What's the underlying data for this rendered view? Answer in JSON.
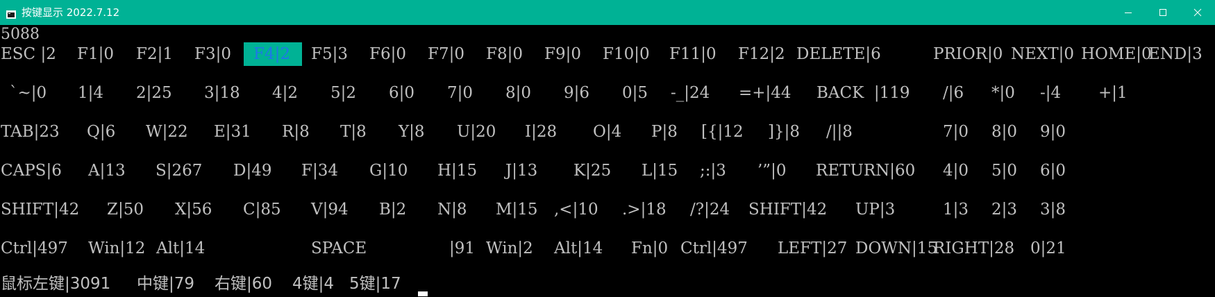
{
  "window": {
    "title": "按键显示 2022.7.12",
    "minimize_glyph": "─",
    "maximize_glyph": "☐",
    "close_glyph": "✕",
    "accent_color": "#00b295"
  },
  "console": {
    "counter": "5088",
    "text_color": "#c0c0c0",
    "highlight_text_color": "#1e78e6"
  },
  "rows": [
    {
      "name": "function-row",
      "keys": [
        {
          "id": "esc",
          "text": "ESC |2"
        },
        {
          "id": "f1",
          "text": "F1|0"
        },
        {
          "id": "f2",
          "text": "F2|1"
        },
        {
          "id": "f3",
          "text": "F3|0"
        },
        {
          "id": "f4",
          "text": "F4|2 ",
          "active": true
        },
        {
          "id": "f5",
          "text": "F5|3"
        },
        {
          "id": "f6",
          "text": "F6|0"
        },
        {
          "id": "f7",
          "text": "F7|0"
        },
        {
          "id": "f8",
          "text": "F8|0"
        },
        {
          "id": "f9",
          "text": "F9|0"
        },
        {
          "id": "f10",
          "text": "F10|0"
        },
        {
          "id": "f11",
          "text": "F11|0"
        },
        {
          "id": "f12",
          "text": "F12|2"
        },
        {
          "id": "delete",
          "text": "DELETE|6"
        },
        {
          "id": "prior",
          "text": "PRIOR|0"
        },
        {
          "id": "next",
          "text": "NEXT|0"
        },
        {
          "id": "home",
          "text": "HOME|0"
        },
        {
          "id": "end",
          "text": "END|3"
        }
      ]
    },
    {
      "name": "number-row",
      "keys": [
        {
          "id": "backtick",
          "text": "`~|0"
        },
        {
          "id": "1",
          "text": "1|4"
        },
        {
          "id": "2",
          "text": "2|25"
        },
        {
          "id": "3",
          "text": "3|18"
        },
        {
          "id": "4",
          "text": "4|2"
        },
        {
          "id": "5",
          "text": "5|2"
        },
        {
          "id": "6",
          "text": "6|0"
        },
        {
          "id": "7",
          "text": "7|0"
        },
        {
          "id": "8",
          "text": "8|0"
        },
        {
          "id": "9",
          "text": "9|6"
        },
        {
          "id": "0",
          "text": "0|5"
        },
        {
          "id": "minus",
          "text": "-_|24"
        },
        {
          "id": "equals",
          "text": "=+|44"
        },
        {
          "id": "back",
          "text": "BACK  |119"
        },
        {
          "id": "num-slash",
          "text": "/|6"
        },
        {
          "id": "num-star",
          "text": "*|0"
        },
        {
          "id": "num-minus",
          "text": "-|4"
        },
        {
          "id": "num-plus",
          "text": "+|1"
        }
      ]
    },
    {
      "name": "tab-row",
      "keys": [
        {
          "id": "tab",
          "text": "TAB|23"
        },
        {
          "id": "q",
          "text": "Q|6"
        },
        {
          "id": "w",
          "text": "W|22"
        },
        {
          "id": "e",
          "text": "E|31"
        },
        {
          "id": "r",
          "text": "R|8"
        },
        {
          "id": "t",
          "text": "T|8"
        },
        {
          "id": "y",
          "text": "Y|8"
        },
        {
          "id": "u",
          "text": "U|20"
        },
        {
          "id": "i",
          "text": "I|28"
        },
        {
          "id": "o",
          "text": "O|4"
        },
        {
          "id": "p",
          "text": "P|8"
        },
        {
          "id": "lbracket",
          "text": "[{|12"
        },
        {
          "id": "rbracket",
          "text": "]}|8"
        },
        {
          "id": "backslash",
          "text": "/||8"
        },
        {
          "id": "num7",
          "text": "7|0"
        },
        {
          "id": "num8",
          "text": "8|0"
        },
        {
          "id": "num9",
          "text": "9|0"
        }
      ]
    },
    {
      "name": "caps-row",
      "keys": [
        {
          "id": "caps",
          "text": "CAPS|6"
        },
        {
          "id": "a",
          "text": "A|13"
        },
        {
          "id": "s",
          "text": "S|267"
        },
        {
          "id": "d",
          "text": "D|49"
        },
        {
          "id": "f",
          "text": "F|34"
        },
        {
          "id": "g",
          "text": "G|10"
        },
        {
          "id": "h",
          "text": "H|15"
        },
        {
          "id": "j",
          "text": "J|13"
        },
        {
          "id": "k",
          "text": "K|25"
        },
        {
          "id": "l",
          "text": "L|15"
        },
        {
          "id": "semicolon",
          "text": ";:|3"
        },
        {
          "id": "quote",
          "text": "’”|0"
        },
        {
          "id": "return",
          "text": "RETURN|60"
        },
        {
          "id": "num4",
          "text": "4|0"
        },
        {
          "id": "num5",
          "text": "5|0"
        },
        {
          "id": "num6",
          "text": "6|0"
        }
      ]
    },
    {
      "name": "shift-row",
      "keys": [
        {
          "id": "lshift",
          "text": "SHIFT|42"
        },
        {
          "id": "z",
          "text": "Z|50"
        },
        {
          "id": "x",
          "text": "X|56"
        },
        {
          "id": "c",
          "text": "C|85"
        },
        {
          "id": "v",
          "text": "V|94"
        },
        {
          "id": "b",
          "text": "B|2"
        },
        {
          "id": "n",
          "text": "N|8"
        },
        {
          "id": "m",
          "text": "M|15"
        },
        {
          "id": "comma",
          "text": ",<|10"
        },
        {
          "id": "period",
          "text": ".>|18"
        },
        {
          "id": "slash",
          "text": "/?|24"
        },
        {
          "id": "rshift",
          "text": "SHIFT|42"
        },
        {
          "id": "up",
          "text": "UP|3"
        },
        {
          "id": "num1",
          "text": "1|3"
        },
        {
          "id": "num2",
          "text": "2|3"
        },
        {
          "id": "num3",
          "text": "3|8"
        }
      ]
    },
    {
      "name": "bottom-row",
      "keys": [
        {
          "id": "lctrl",
          "text": "Ctrl|497"
        },
        {
          "id": "lwin",
          "text": "Win|12"
        },
        {
          "id": "lalt",
          "text": "Alt|14"
        },
        {
          "id": "space-label",
          "text": "SPACE"
        },
        {
          "id": "space-count",
          "text": "|91"
        },
        {
          "id": "rwin",
          "text": "Win|2"
        },
        {
          "id": "ralt",
          "text": "Alt|14"
        },
        {
          "id": "fn",
          "text": "Fn|0"
        },
        {
          "id": "rctrl",
          "text": "Ctrl|497"
        },
        {
          "id": "left",
          "text": "LEFT|27"
        },
        {
          "id": "down",
          "text": "DOWN|15"
        },
        {
          "id": "right",
          "text": "RIGHT|28"
        },
        {
          "id": "num0",
          "text": "0|21"
        }
      ]
    },
    {
      "name": "mouse-row",
      "keys": [
        {
          "id": "mouse-left",
          "text": "鼠标左键|3091"
        },
        {
          "id": "mouse-middle",
          "text": "中键|79"
        },
        {
          "id": "mouse-right",
          "text": "右键|60"
        },
        {
          "id": "mouse-4",
          "text": "4键|4"
        },
        {
          "id": "mouse-5",
          "text": "5键|17"
        }
      ]
    }
  ]
}
